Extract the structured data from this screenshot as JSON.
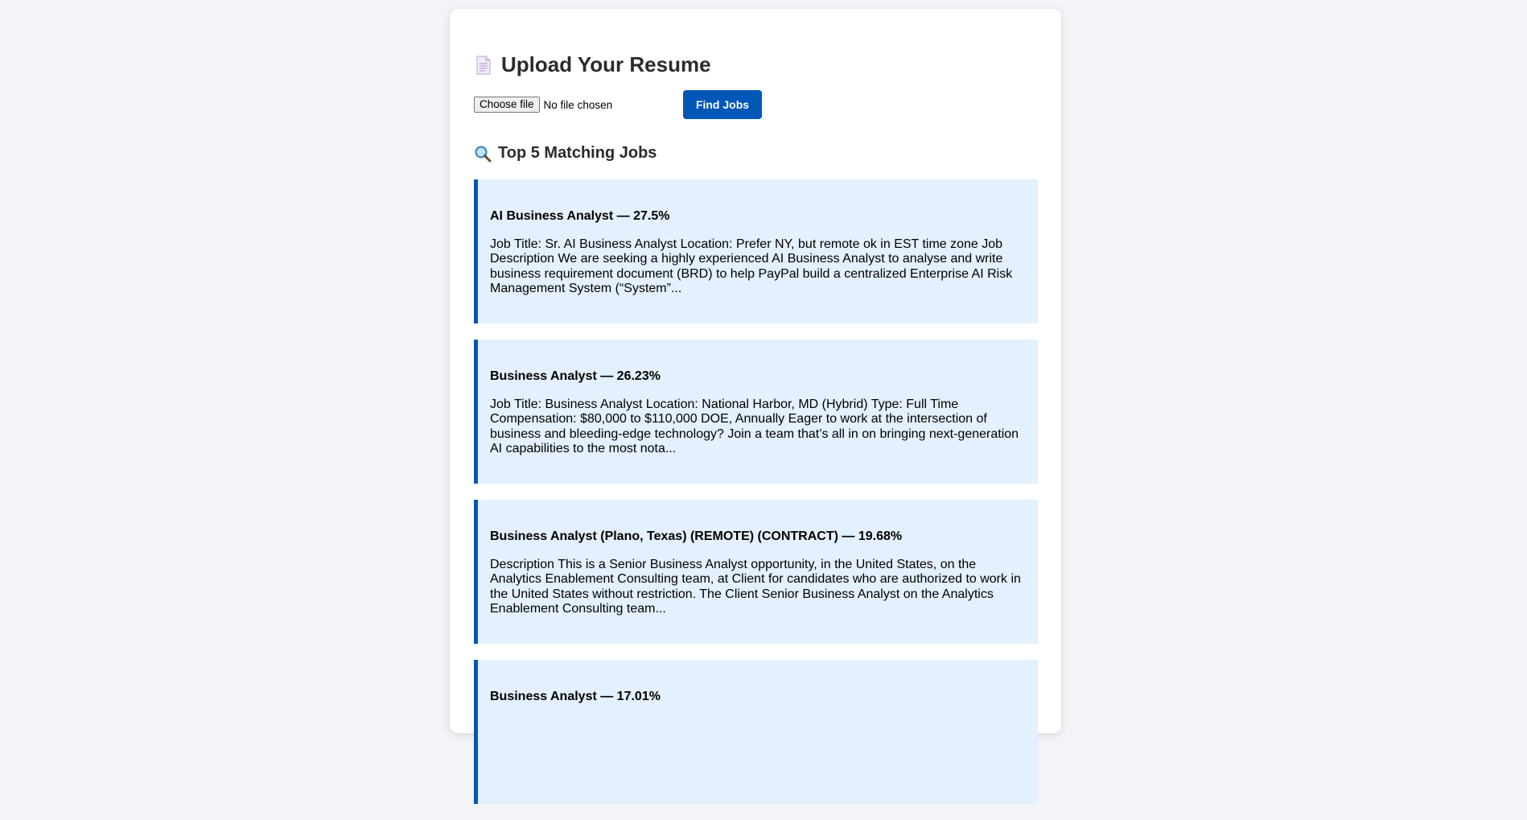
{
  "upload": {
    "title": "Upload Your Resume",
    "choose_file_label": "Choose file",
    "file_status": "No file chosen",
    "find_jobs_label": "Find Jobs"
  },
  "results": {
    "title": "Top 5 Matching Jobs",
    "jobs": [
      {
        "title": "AI Business Analyst — 27.5%",
        "description": "Job Title: Sr. AI Business Analyst Location: Prefer NY, but remote ok in EST time zone Job Description We are seeking a highly experienced AI Business Analyst to analyse and write business requirement document (BRD) to help PayPal build a centralized Enterprise AI Risk Management System (“System”..."
      },
      {
        "title": "Business Analyst — 26.23%",
        "description": "Job Title: Business Analyst Location: National Harbor, MD (Hybrid) Type: Full Time Compensation: $80,000 to $110,000 DOE, Annually Eager to work at the intersection of business and bleeding-edge technology? Join a team that’s all in on bringing next-generation AI capabilities to the most nota..."
      },
      {
        "title": "Business Analyst (Plano, Texas) (REMOTE) (CONTRACT) — 19.68%",
        "description": "Description This is a Senior Business Analyst opportunity, in the United States, on the Analytics Enablement Consulting team, at Client for candidates who are authorized to work in the United States without restriction. The Client Senior Business Analyst on the Analytics Enablement Consulting team..."
      },
      {
        "title": "Business Analyst — 17.01%",
        "description": ""
      }
    ]
  },
  "colors": {
    "accent": "#0057b8",
    "job_card_bg": "#e3f0fd",
    "page_bg": "#f2f4f7"
  },
  "icons": {
    "header_icon": "document-icon",
    "results_icon": "search-icon"
  }
}
